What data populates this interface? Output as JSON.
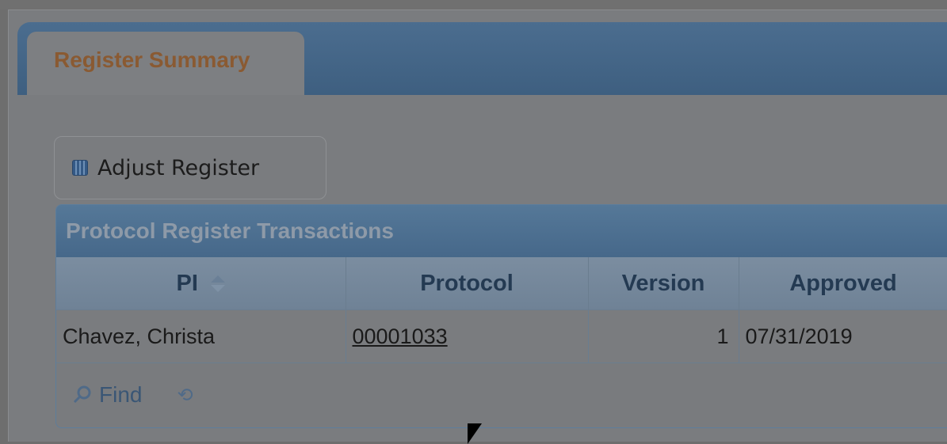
{
  "tab": {
    "label": "Register Summary"
  },
  "actions": {
    "adjust_label": "Adjust Register"
  },
  "grid": {
    "caption": "Protocol Register Transactions",
    "columns": [
      "PI",
      "Protocol",
      "Version",
      "Approved"
    ],
    "rows": [
      {
        "pi": "Chavez, Christa",
        "protocol": "00001033",
        "version": "1",
        "approved": "07/31/2019"
      }
    ]
  },
  "pager": {
    "find_label": "Find",
    "refresh_icon": "refresh-icon"
  },
  "colors": {
    "accent": "#46688a",
    "tab_text": "#8a5a32"
  }
}
